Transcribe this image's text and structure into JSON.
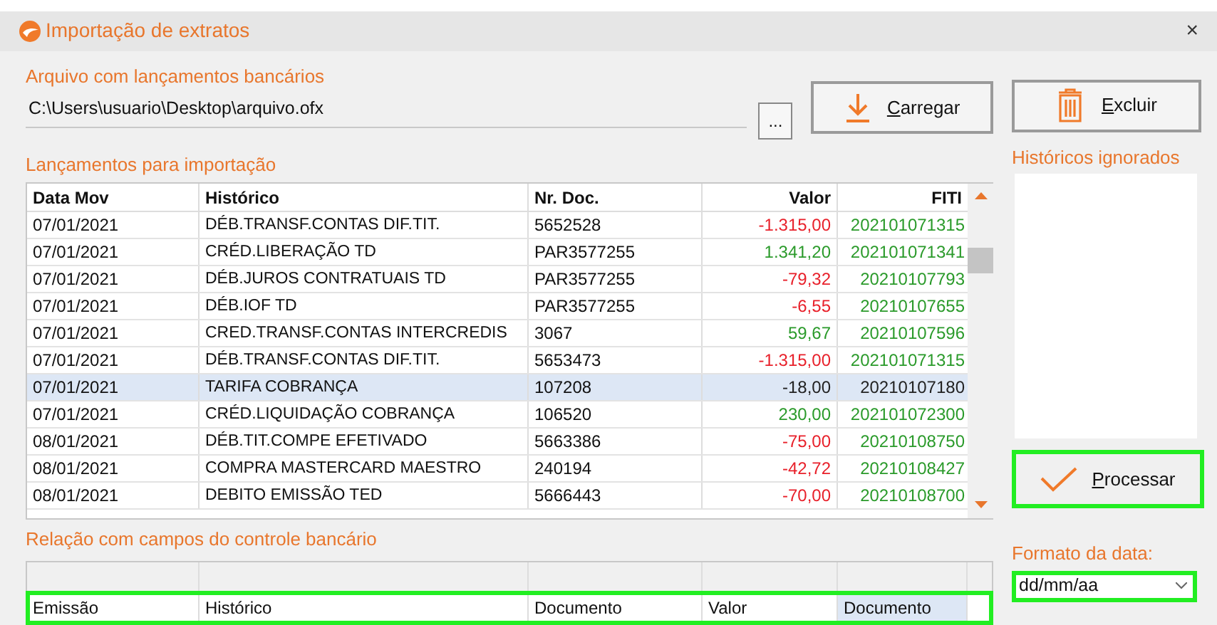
{
  "window": {
    "title": "Importação de extratos",
    "close": "×"
  },
  "file": {
    "label": "Arquivo com lançamentos bancários",
    "value": "C:\\Users\\usuario\\Desktop\\arquivo.ofx",
    "browse": "..."
  },
  "buttons": [
    {
      "label": "Carregar",
      "kind": "download"
    },
    {
      "label": "Excluir",
      "kind": "trash"
    }
  ],
  "entries": {
    "label": "Lançamentos para importação",
    "columns": [
      "Data Mov",
      "Histórico",
      "Nr. Doc.",
      "Valor",
      "FITI"
    ],
    "rows": [
      {
        "date": "07/01/2021",
        "history": "DÉB.TRANSF.CONTAS DIF.TIT.",
        "doc": "5652528",
        "value": "-1.315,00",
        "kind": "debit",
        "fiti": "202101071315",
        "selected": false
      },
      {
        "date": "07/01/2021",
        "history": "CRÉD.LIBERAÇÃO TD",
        "doc": "PAR3577255",
        "value": "1.341,20",
        "kind": "credit",
        "fiti": "202101071341",
        "selected": false
      },
      {
        "date": "07/01/2021",
        "history": "DÉB.JUROS CONTRATUAIS TD",
        "doc": "PAR3577255",
        "value": "-79,32",
        "kind": "debit",
        "fiti": "20210107793",
        "selected": false
      },
      {
        "date": "07/01/2021",
        "history": "DÉB.IOF TD",
        "doc": "PAR3577255",
        "value": "-6,55",
        "kind": "debit",
        "fiti": "20210107655",
        "selected": false
      },
      {
        "date": "07/01/2021",
        "history": "CRED.TRANSF.CONTAS INTERCREDIS",
        "doc": "3067",
        "value": "59,67",
        "kind": "credit",
        "fiti": "20210107596",
        "selected": false
      },
      {
        "date": "07/01/2021",
        "history": "DÉB.TRANSF.CONTAS DIF.TIT.",
        "doc": "5653473",
        "value": "-1.315,00",
        "kind": "debit",
        "fiti": "202101071315",
        "selected": false
      },
      {
        "date": "07/01/2021",
        "history": "TARIFA COBRANÇA",
        "doc": "107208",
        "value": "-18,00",
        "kind": "debit",
        "fiti": "20210107180",
        "selected": true
      },
      {
        "date": "07/01/2021",
        "history": "CRÉD.LIQUIDAÇÃO COBRANÇA",
        "doc": "106520",
        "value": "230,00",
        "kind": "credit",
        "fiti": "202101072300",
        "selected": false
      },
      {
        "date": "08/01/2021",
        "history": "DÉB.TIT.COMPE EFETIVADO",
        "doc": "5663386",
        "value": "-75,00",
        "kind": "debit",
        "fiti": "20210108750",
        "selected": false
      },
      {
        "date": "08/01/2021",
        "history": "COMPRA MASTERCARD MAESTRO",
        "doc": "240194",
        "value": "-42,72",
        "kind": "debit",
        "fiti": "20210108427",
        "selected": false
      },
      {
        "date": "08/01/2021",
        "history": "DEBITO EMISSÃO TED",
        "doc": "5666443",
        "value": "-70,00",
        "kind": "debit",
        "fiti": "20210108700",
        "selected": false
      }
    ]
  },
  "ignored": {
    "label": "Históricos ignorados"
  },
  "process": {
    "label": "Processar",
    "highlighted": true
  },
  "mapping": {
    "label": "Relação com campos do controle bancário",
    "highlighted": true,
    "fields": [
      {
        "label": "Emissão",
        "selected": false
      },
      {
        "label": "Histórico",
        "selected": false
      },
      {
        "label": "Documento",
        "selected": false
      },
      {
        "label": "Valor",
        "selected": false
      },
      {
        "label": "Documento",
        "selected": true
      }
    ]
  },
  "date_format": {
    "label": "Formato da data:",
    "value": "dd/mm/aa",
    "highlighted": true
  }
}
